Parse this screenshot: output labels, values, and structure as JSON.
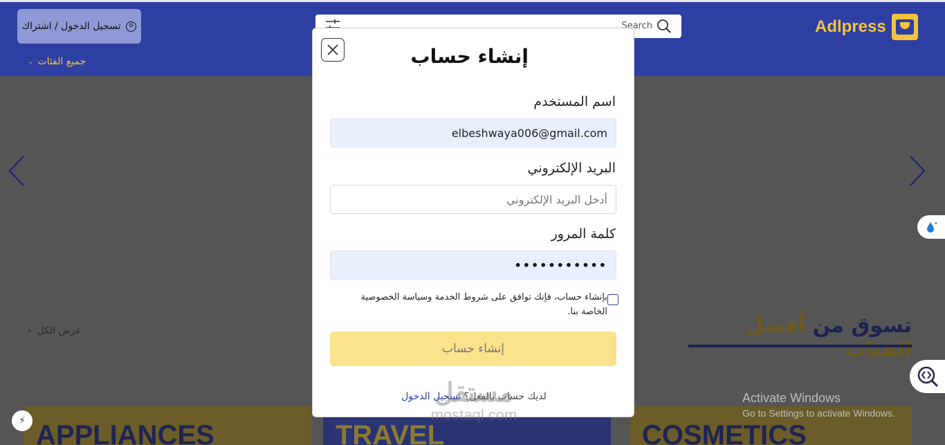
{
  "header": {
    "login_label": "تسجيل الدخول / اشتراك",
    "categories_label": "جميع الفئات",
    "search_placeholder": "Search",
    "logo_text": "Adlpress",
    "brand_color": "#2e3fa3",
    "accent_color": "#f5c33b"
  },
  "page": {
    "shop_title_part1": "تسوق من",
    "shop_title_part2": "أفضل الفئات",
    "view_all": "عرض الكل",
    "categories": [
      "APPLIANCES",
      "TRAVEL",
      "COSMETICS"
    ]
  },
  "modal": {
    "title": "إنشاء حساب",
    "username_label": "اسم المستخدم",
    "username_value": "elbeshwaya006@gmail.com",
    "email_label": "البريد الإلكتروني",
    "email_placeholder": "أدخل البريد الإلكتروني",
    "password_label": "كلمة المرور",
    "password_value": "•••••••••••",
    "terms_text": "بإنشاء حساب، فإنك توافق على شروط الخدمة وسياسة الخصوصية الخاصة بنا.",
    "submit_label": "إنشاء حساب",
    "have_account_text": "لديك حساب بالفعل؟",
    "login_link": "تسجيل الدخول"
  },
  "watermark": {
    "arabic": "مستقل",
    "latin": "mostaql.com"
  },
  "windows": {
    "activate_title": "Activate Windows",
    "activate_sub": "Go to Settings to activate Windows."
  }
}
